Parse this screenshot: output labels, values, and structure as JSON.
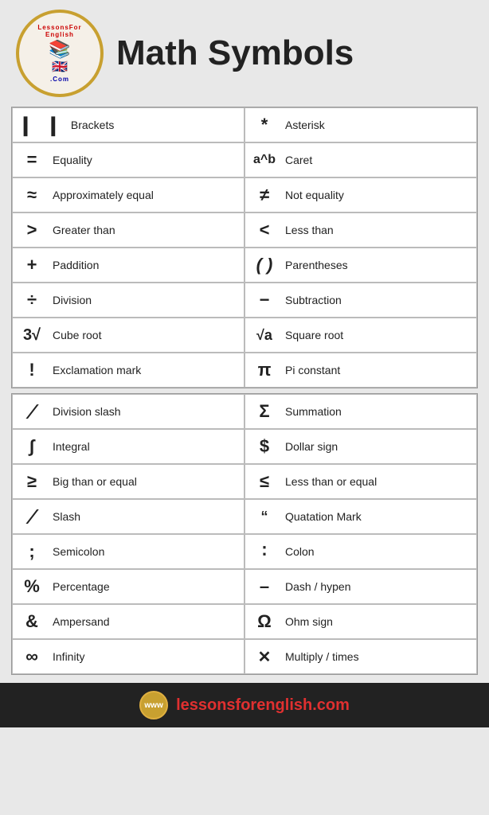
{
  "page": {
    "title": "Math Symbols",
    "footer_url": "lessonsforenglish.com"
  },
  "top_table": {
    "left": [
      {
        "symbol": "⌈⌋",
        "label": "Brackets",
        "type": "brackets"
      },
      {
        "symbol": "=",
        "label": "Equality"
      },
      {
        "symbol": "≈",
        "label": "Approximately equal"
      },
      {
        "symbol": ">",
        "label": "Greater than"
      },
      {
        "symbol": "+",
        "label": "Paddition"
      },
      {
        "symbol": "÷",
        "label": "Division"
      },
      {
        "symbol": "3√",
        "label": "Cube root"
      },
      {
        "symbol": "!",
        "label": "Exclamation mark"
      }
    ],
    "right": [
      {
        "symbol": "*",
        "label": "Asterisk"
      },
      {
        "symbol": "a^b",
        "label": "Caret",
        "bold": true
      },
      {
        "symbol": "≠",
        "label": "Not equality"
      },
      {
        "symbol": "<",
        "label": "Less than"
      },
      {
        "symbol": "()",
        "label": "Parentheses"
      },
      {
        "symbol": "−",
        "label": "Subtraction"
      },
      {
        "symbol": "√a",
        "label": "Square root"
      },
      {
        "symbol": "π",
        "label": "Pi constant"
      }
    ]
  },
  "bottom_table": {
    "left": [
      {
        "symbol": "∕",
        "label": "Division slash"
      },
      {
        "symbol": "∫",
        "label": "Integral"
      },
      {
        "symbol": "≥",
        "label": "Big than or equal"
      },
      {
        "symbol": "⁄",
        "label": "Slash"
      },
      {
        "symbol": ";",
        "label": "Semicolon"
      },
      {
        "symbol": "%",
        "label": "Percentage"
      },
      {
        "symbol": "&",
        "label": "Ampersand"
      },
      {
        "symbol": "∞",
        "label": "Infinity"
      }
    ],
    "right": [
      {
        "symbol": "Σ",
        "label": "Summation"
      },
      {
        "symbol": "$",
        "label": "Dollar sign"
      },
      {
        "symbol": "≤",
        "label": "Less than or equal"
      },
      {
        "symbol": "❝",
        "label": "Quatation Mark"
      },
      {
        "symbol": "∶",
        "label": "Colon"
      },
      {
        "symbol": "–",
        "label": "Dash / hypen"
      },
      {
        "symbol": "Ω",
        "label": "Ohm sign"
      },
      {
        "symbol": "✕",
        "label": "Multiply / times"
      }
    ]
  }
}
